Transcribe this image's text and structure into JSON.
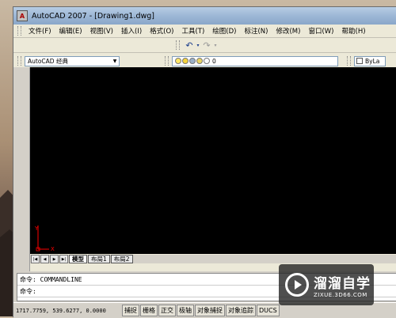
{
  "window": {
    "title": "AutoCAD 2007 - [Drawing1.dwg]",
    "icon_letter": "A"
  },
  "menu": {
    "items": [
      "文件(F)",
      "编辑(E)",
      "视图(V)",
      "插入(I)",
      "格式(O)",
      "工具(T)",
      "绘图(D)",
      "标注(N)",
      "修改(M)",
      "窗口(W)",
      "帮助(H)"
    ]
  },
  "toolbar": {
    "workspace_value": "AutoCAD 经典",
    "layer_value": "0",
    "color_value": "ByLa",
    "undo_icon": "undo-icon",
    "redo_icon": "redo-icon"
  },
  "layout_tabs": {
    "tabs": [
      "模型",
      "布局1",
      "布局2"
    ],
    "active": "模型"
  },
  "ucs": {
    "x": "X",
    "y": "Y"
  },
  "command": {
    "line1": "命令: COMMANDLINE",
    "line2": "命令:"
  },
  "status": {
    "coordinates": "1717.7759, 539.6277, 0.0000",
    "buttons": [
      "捕捉",
      "栅格",
      "正交",
      "极轴",
      "对象捕捉",
      "对象追踪",
      "DUCS"
    ]
  },
  "watermark": {
    "title": "溜溜自学",
    "subtitle": "ZIXUE.3D66.COM"
  },
  "colors": {
    "canvas": "#000000",
    "ucs": "#ff0000",
    "titlebar": "#9db7d6"
  }
}
